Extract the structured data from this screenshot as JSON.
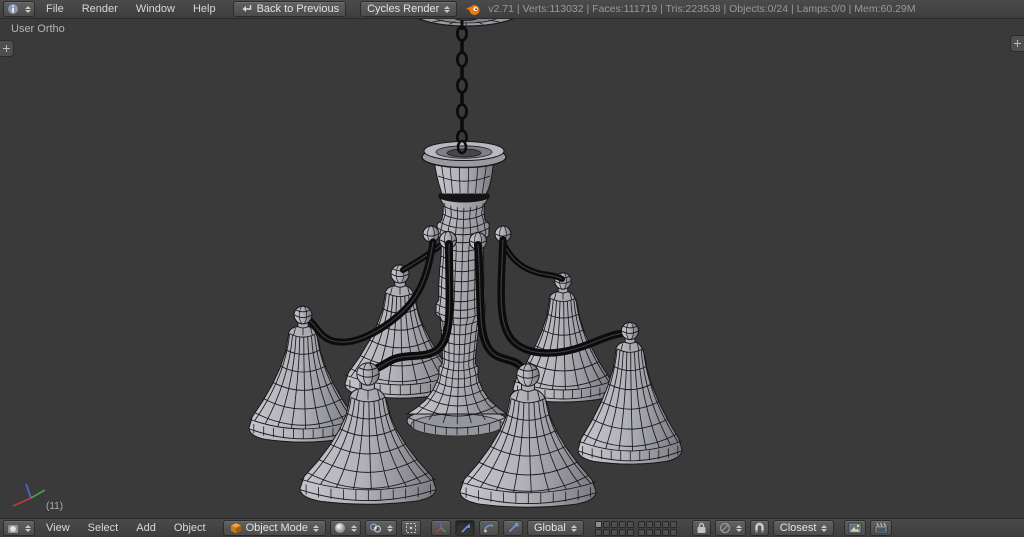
{
  "info_bar": {
    "menus": [
      "File",
      "Render",
      "Window",
      "Help"
    ],
    "back_button_label": "Back to Previous",
    "engine_value": "Cycles Render",
    "stats": "v2.71 | Verts:113032 | Faces:111719 | Tris:223538 | Objects:0/24 | Lamps:0/0 | Mem:60.29M"
  },
  "viewport": {
    "view_label": "User Ortho",
    "selection_count": "(11)"
  },
  "tool_bar": {
    "menus": [
      "View",
      "Select",
      "Add",
      "Object"
    ],
    "mode_value": "Object Mode",
    "orientation_value": "Global",
    "snap_target_value": "Closest",
    "layers_active_index": 0,
    "layer_groups": 2,
    "layers_per_group": 10
  },
  "colors": {
    "accent_orange": "#e87d0d",
    "viewport_bg": "#3a3a3a",
    "mesh_light": "#c4c5cb",
    "mesh_mid": "#b2b3b9",
    "mesh_dark": "#8e8f95",
    "mesh_darker": "#797a80",
    "wire": "#17171a",
    "arm_dark": "#0c0c0c",
    "axis_x": "#c23b3b",
    "axis_y": "#4f9e4f",
    "axis_z": "#4a6fd0"
  }
}
